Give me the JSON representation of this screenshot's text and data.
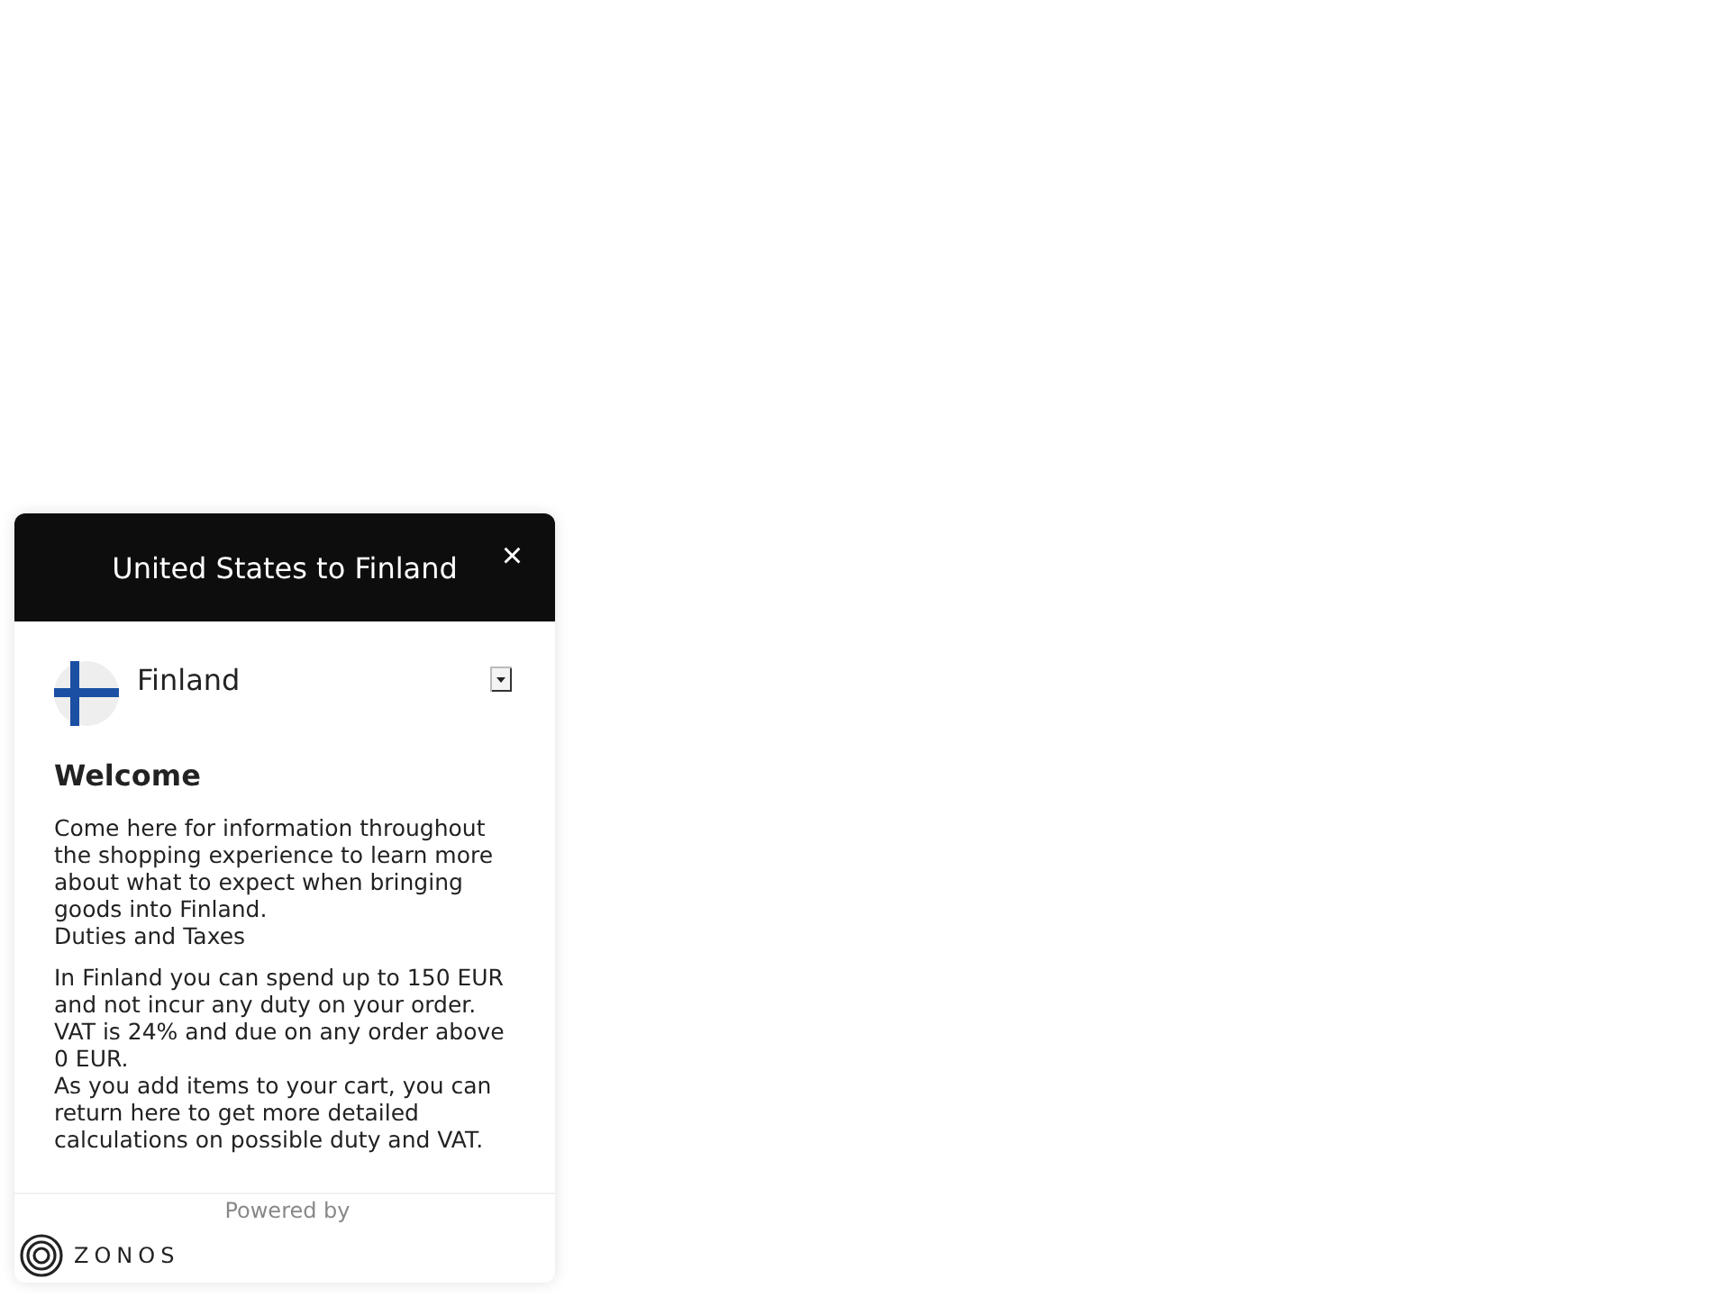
{
  "header": {
    "title": "United States to Finland",
    "close": "×"
  },
  "country_select": {
    "value": "Finland"
  },
  "welcome": {
    "heading": "Welcome",
    "intro": "Come here for information throughout the shopping experience to learn more about what to expect when bringing goods into Finland.",
    "section_title": "Duties and Taxes",
    "paragraphs": [
      "In Finland you can spend up to 150 EUR and not incur any duty on your order. VAT is 24% and due on any order above 0 EUR.",
      "As you add items to your cart, you can return here to get more detailed calculations on possible duty and VAT."
    ]
  },
  "footer": {
    "powered_by": "Powered by",
    "brand": "ZONOS"
  }
}
